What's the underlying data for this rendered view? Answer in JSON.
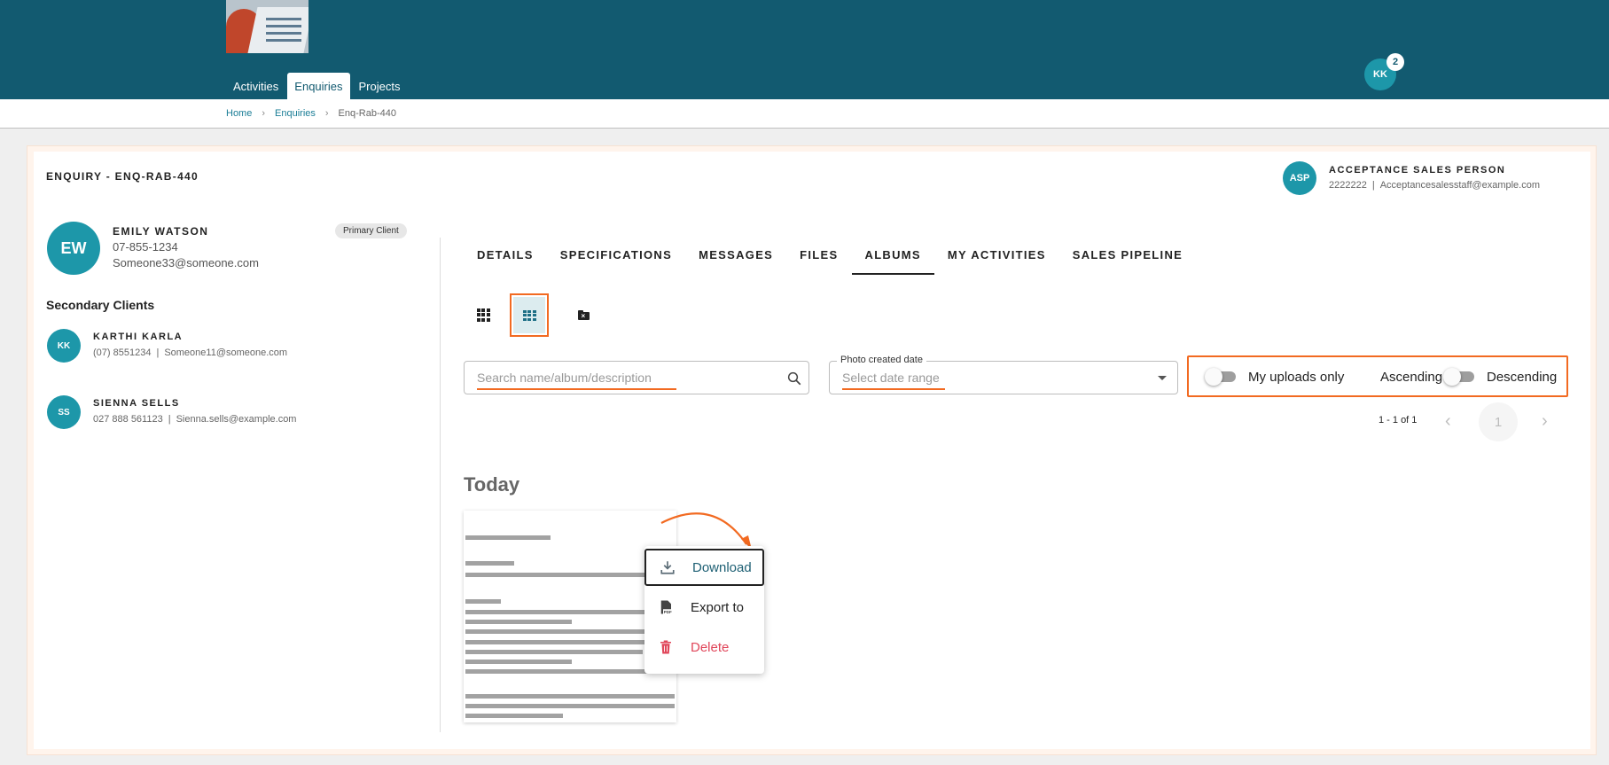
{
  "header": {
    "nav": [
      "Activities",
      "Enquiries",
      "Projects"
    ],
    "active_nav": "Enquiries",
    "user_initials": "KK",
    "notification_count": "2",
    "brand_color": "#125a70"
  },
  "breadcrumb": {
    "home": "Home",
    "enquiries": "Enquiries",
    "current": "Enq-Rab-440"
  },
  "enquiry": {
    "title": "ENQUIRY - ENQ-RAB-440"
  },
  "sales_person": {
    "initials": "ASP",
    "name": "ACCEPTANCE SALES PERSON",
    "phone": "2222222",
    "email": "Acceptancesalesstaff@example.com"
  },
  "client": {
    "initials": "EW",
    "name": "EMILY WATSON",
    "phone": "07-855-1234",
    "email": "Someone33@someone.com",
    "tag": "Primary Client"
  },
  "secondary": {
    "heading": "Secondary Clients",
    "clients": [
      {
        "initials": "KK",
        "name": "KARTHI KARLA",
        "phone": "(07) 8551234",
        "email": "Someone11@someone.com"
      },
      {
        "initials": "SS",
        "name": "SIENNA SELLS",
        "phone": "027 888 561123",
        "email": "Sienna.sells@example.com"
      }
    ]
  },
  "tabs": [
    "DETAILS",
    "SPECIFICATIONS",
    "MESSAGES",
    "FILES",
    "ALBUMS",
    "MY ACTIVITIES",
    "SALES PIPELINE"
  ],
  "active_tab": "ALBUMS",
  "filters": {
    "search_placeholder": "Search name/album/description",
    "date_label": "Photo created date",
    "date_placeholder": "Select date range",
    "my_uploads_label": "My uploads only",
    "ascending_label": "Ascending",
    "descending_label": "Descending",
    "my_uploads_on": false,
    "sort_descending": false
  },
  "pagination": {
    "range": "1 - 1 of 1",
    "page": "1",
    "prev_icon": "chevron-left-icon",
    "next_icon": "chevron-right-icon"
  },
  "album": {
    "group_heading": "Today"
  },
  "context_menu": {
    "items": [
      {
        "label": "Download",
        "icon": "download-icon",
        "color": "#1d5f73"
      },
      {
        "label": "Export to",
        "icon": "pdf-icon",
        "color": "#222222"
      },
      {
        "label": "Delete",
        "icon": "trash-icon",
        "color": "#e0465a"
      }
    ]
  },
  "colors": {
    "accent": "#1d97a9",
    "highlight": "#f26a21",
    "delete": "#e0465a"
  }
}
